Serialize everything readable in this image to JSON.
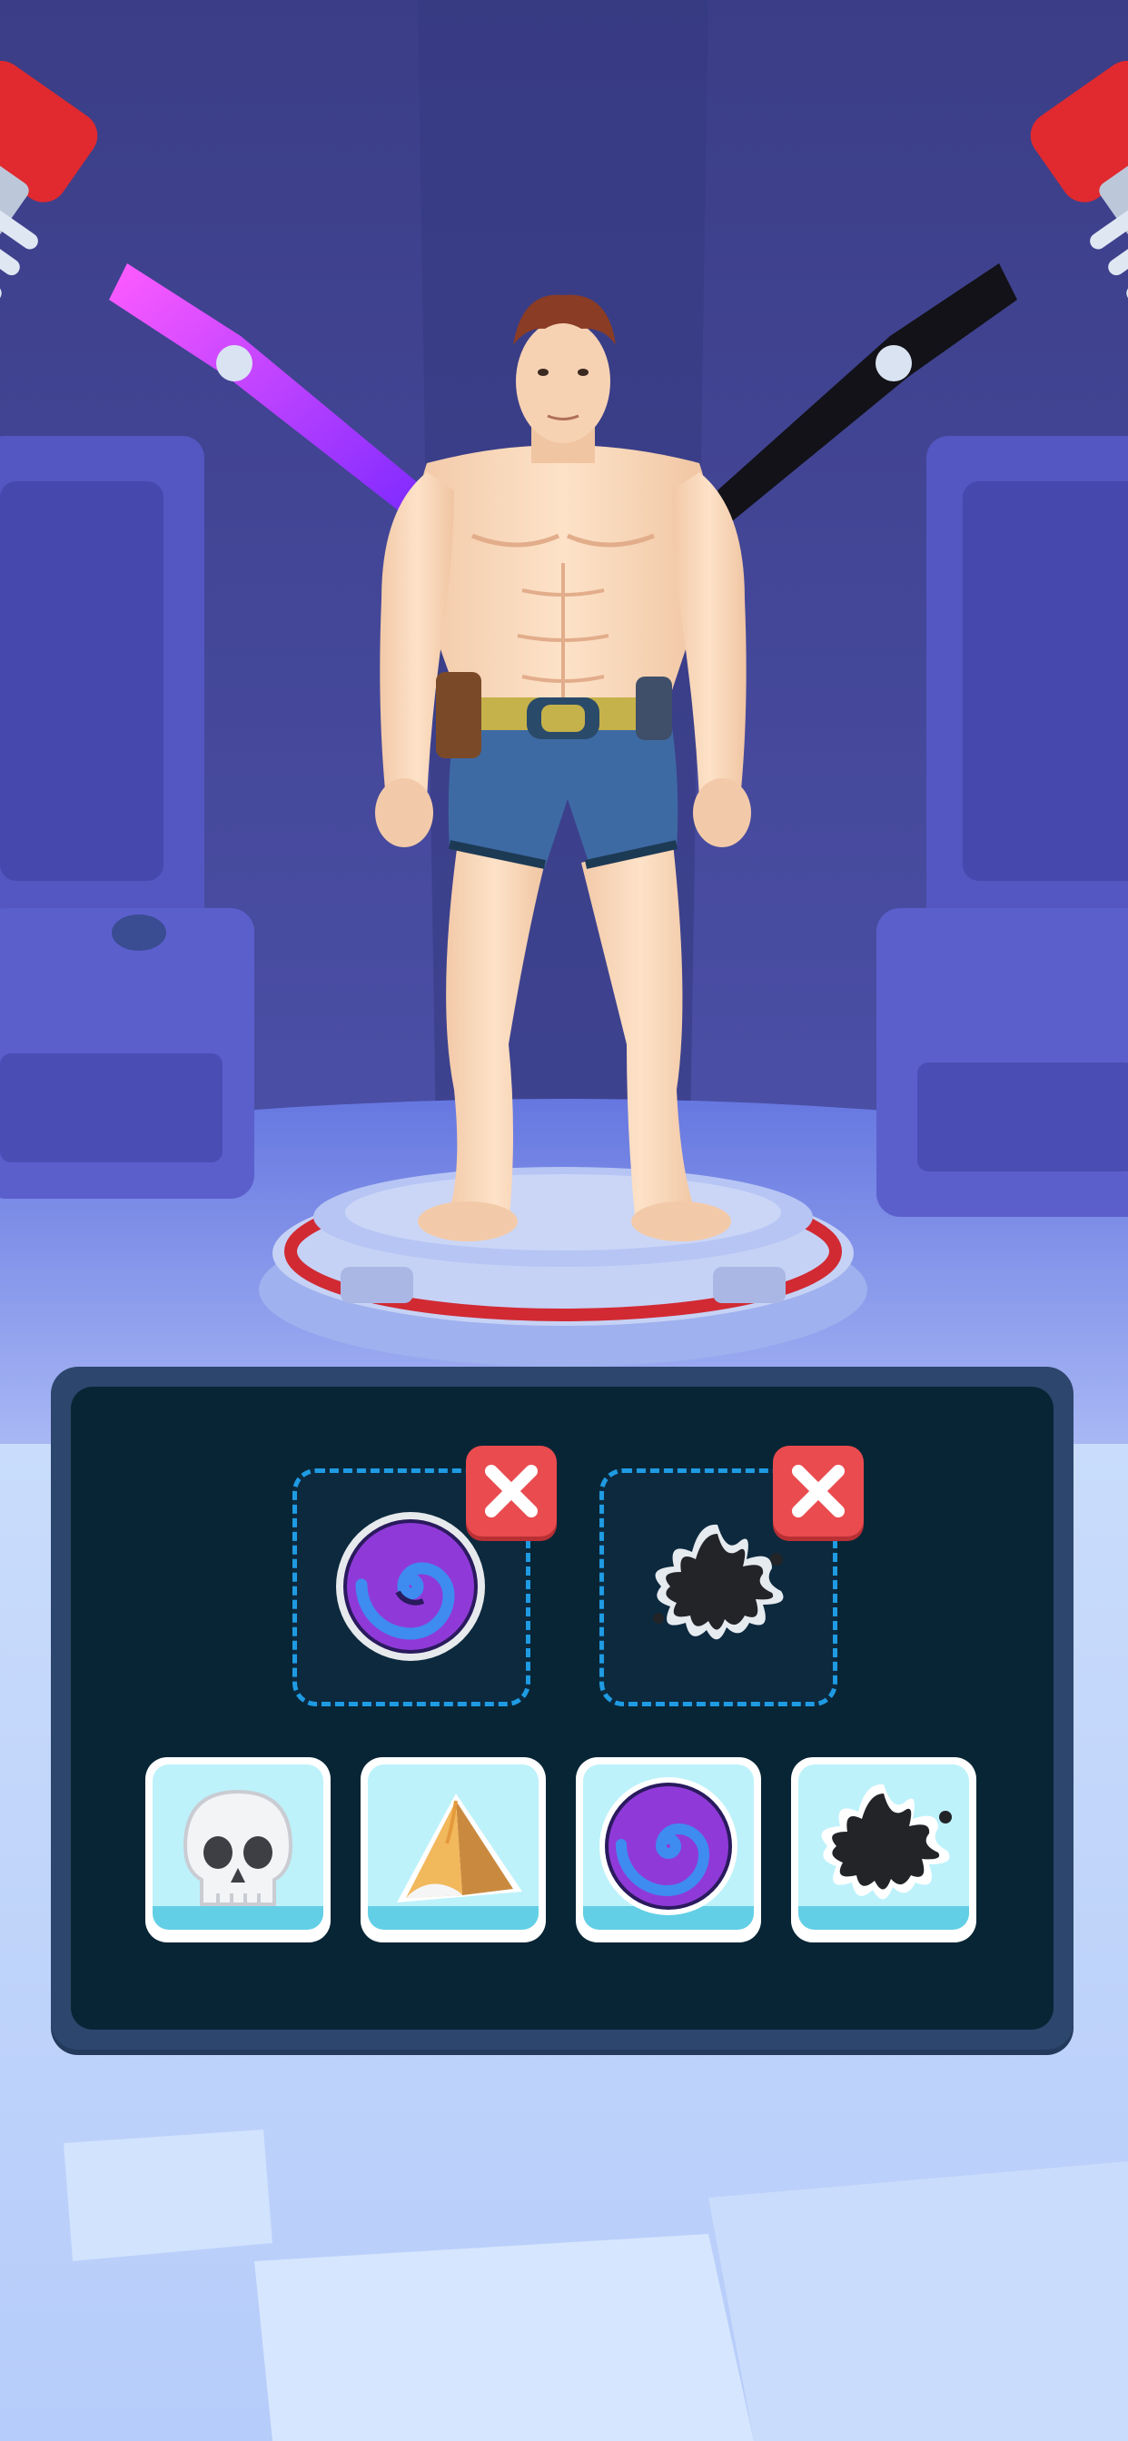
{
  "screen": "character-ability-loadout",
  "character": {
    "name": "muscular-hero",
    "pose": "standing-on-pedestal"
  },
  "lasers": [
    {
      "side": "left",
      "color": "#c531ff"
    },
    {
      "side": "right",
      "color": "#111111"
    }
  ],
  "selected_slots": [
    {
      "ability": "vortex",
      "icon": "vortex-icon",
      "remove_icon": "close-icon"
    },
    {
      "ability": "ink-splat",
      "icon": "splat-icon",
      "remove_icon": "close-icon"
    }
  ],
  "inventory": [
    {
      "ability": "skull",
      "icon": "skull-icon"
    },
    {
      "ability": "pyramid",
      "icon": "pyramid-icon"
    },
    {
      "ability": "vortex",
      "icon": "vortex-icon"
    },
    {
      "ability": "ink-splat",
      "icon": "splat-icon"
    }
  ],
  "colors": {
    "panel_bg": "#082535",
    "panel_border": "#2d466d",
    "slot_dash": "#1f9be3",
    "remove_button": "#e94b4f",
    "card_bg": "#bdf2fb",
    "vortex_purple": "#8f3ad8",
    "vortex_blue": "#3e8cf0"
  }
}
